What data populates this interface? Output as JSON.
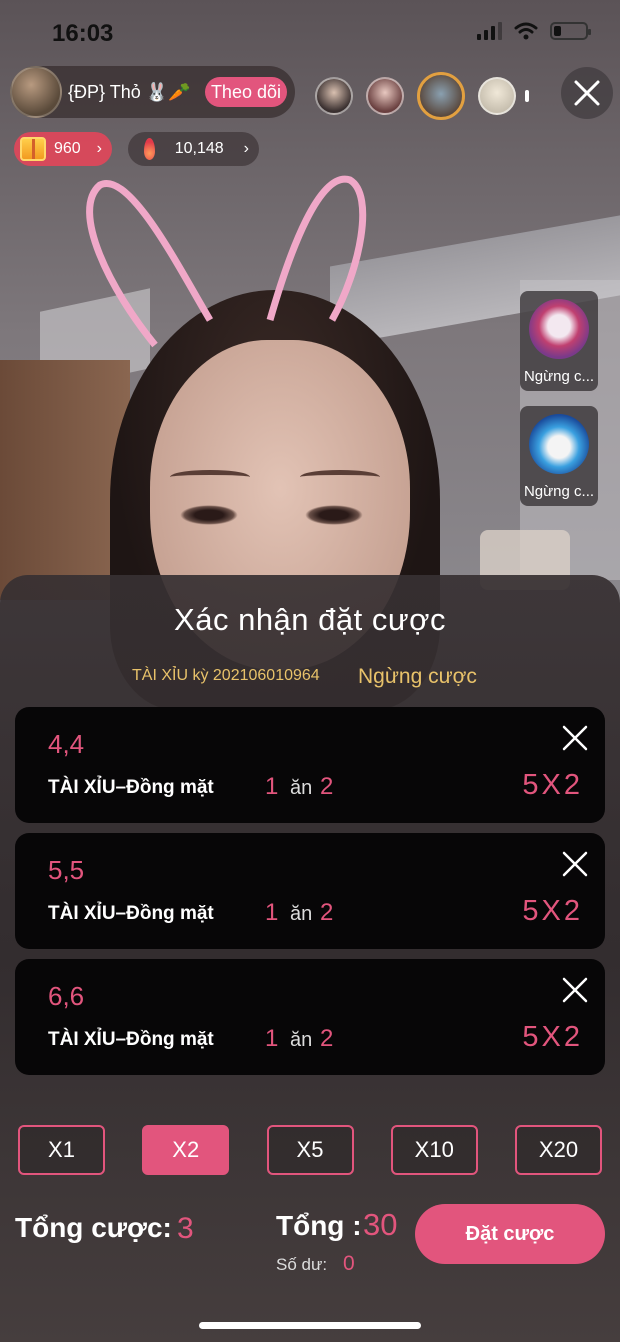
{
  "status_bar": {
    "time": "16:03"
  },
  "host": {
    "name": "{ĐP} Thỏ 🐰🥕",
    "follow_label": "Theo dõi"
  },
  "stats": {
    "gifts": "960",
    "gifts_chevron": "›",
    "popularity": "10,148",
    "popularity_chevron": "›"
  },
  "games": [
    {
      "label": "Ngừng c..."
    },
    {
      "label": "Ngừng c..."
    }
  ],
  "sheet": {
    "title": "Xác nhận đặt cược",
    "round_info": "TÀI XỈU kỳ 202106010964",
    "round_status": "Ngừng cược",
    "bets": [
      {
        "pick": "4,4",
        "type": "TÀI XỈU–Đồng mặt",
        "stake": "1",
        "word": "ăn",
        "payout": "2",
        "amount": "5X2"
      },
      {
        "pick": "5,5",
        "type": "TÀI XỈU–Đồng mặt",
        "stake": "1",
        "word": "ăn",
        "payout": "2",
        "amount": "5X2"
      },
      {
        "pick": "6,6",
        "type": "TÀI XỈU–Đồng mặt",
        "stake": "1",
        "word": "ăn",
        "payout": "2",
        "amount": "5X2"
      }
    ],
    "multipliers": [
      {
        "label": "X1"
      },
      {
        "label": "X2"
      },
      {
        "label": "X5"
      },
      {
        "label": "X10"
      },
      {
        "label": "X20"
      }
    ],
    "selected_multiplier": "X2",
    "total_bet_label": "Tổng cược:",
    "total_bet_value": "3",
    "total_label": "Tổng :",
    "total_value": "30",
    "balance_label": "Số dư:",
    "balance_value": "0",
    "place_bet_label": "Đặt cược"
  },
  "colors": {
    "accent": "#e2557d",
    "gold": "#e8c26a",
    "card": "#070607"
  }
}
